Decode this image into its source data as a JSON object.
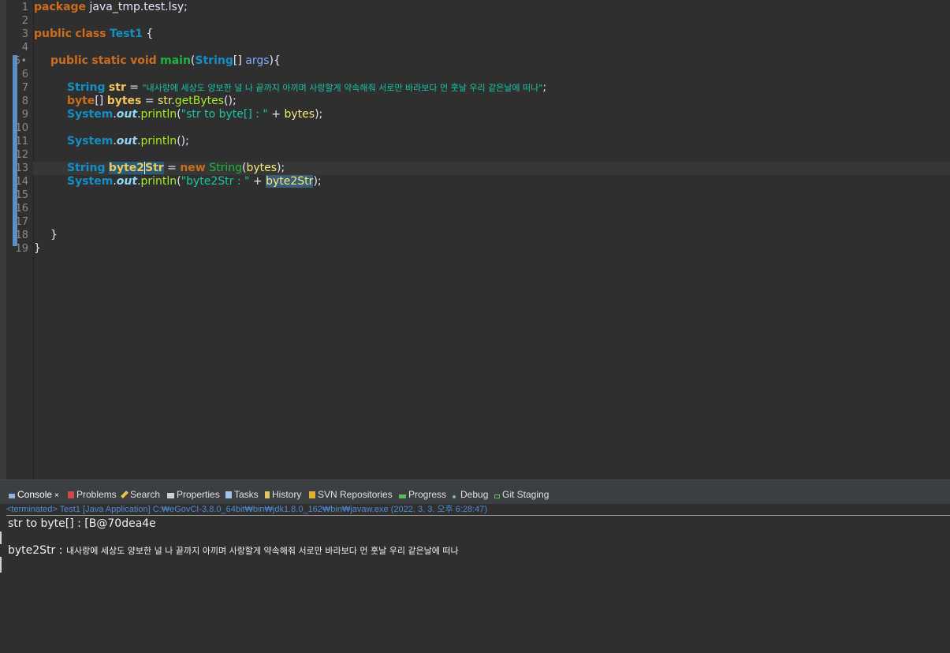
{
  "editor": {
    "line_numbers": [
      "1",
      "2",
      "3",
      "4",
      "5",
      "6",
      "7",
      "8",
      "9",
      "10",
      "11",
      "12",
      "13",
      "14",
      "15",
      "16",
      "17",
      "18",
      "19"
    ],
    "line5_marker": "•",
    "l1": {
      "kw": "package",
      "rest": " java_tmp.test.lsy;"
    },
    "l3": {
      "kw1": "public",
      "kw2": "class",
      "name": "Test1",
      "rest": " {"
    },
    "l5": {
      "kw1": "public",
      "kw2": "static",
      "kw3": "void",
      "fn": "main",
      "p1": "(",
      "type": "String",
      "p2": "[] ",
      "arg": "args",
      "p3": "){"
    },
    "l7": {
      "type": "String",
      "var": "str",
      "eq": " = ",
      "str": "\"내사랑에 세상도 양보한 널 나 끝까지 아끼며 사랑할게 약속해줘 서로만 바라보다 먼 훗날 우리 같은날에 떠나\"",
      "end": ";"
    },
    "l8": {
      "type": "byte",
      "br": "[] ",
      "var": "bytes",
      "eq": " = ",
      "obj": "str",
      "dot": ".",
      "meth": "getBytes",
      "end": "();"
    },
    "l9": {
      "cls": "System",
      "dot1": ".",
      "field": "out",
      "dot2": ".",
      "meth": "println",
      "p1": "(",
      "str": "\"str to byte[] : \"",
      "plus": " + ",
      "var": "bytes",
      "end": ");"
    },
    "l11": {
      "cls": "System",
      "dot1": ".",
      "field": "out",
      "dot2": ".",
      "meth": "println",
      "end": "();"
    },
    "l13": {
      "type": "String",
      "var_a": "byte2",
      "var_b": "S",
      "var_c": "tr",
      "eq": " = ",
      "kw": "new",
      "cls": " String",
      "p1": "(",
      "var2": "bytes",
      "end": ");"
    },
    "l14": {
      "cls": "System",
      "dot1": ".",
      "field": "out",
      "dot2": ".",
      "meth": "println",
      "p1": "(",
      "str": "\"byte2Str : \"",
      "plus": " + ",
      "var": "byte2Str",
      "end": ");"
    },
    "l18": {
      "brace": "}"
    },
    "l19": {
      "brace": "}"
    }
  },
  "console": {
    "tabs": [
      {
        "label": "Console",
        "icon": "console-icon"
      },
      {
        "label": "Problems",
        "icon": "problems-icon"
      },
      {
        "label": "Search",
        "icon": "search-icon"
      },
      {
        "label": "Properties",
        "icon": "properties-icon"
      },
      {
        "label": "Tasks",
        "icon": "tasks-icon"
      },
      {
        "label": "History",
        "icon": "history-icon"
      },
      {
        "label": "SVN Repositories",
        "icon": "svn-icon"
      },
      {
        "label": "Progress",
        "icon": "progress-icon"
      },
      {
        "label": "Debug",
        "icon": "debug-icon"
      },
      {
        "label": "Git Staging",
        "icon": "git-staging-icon"
      }
    ],
    "close_glyph": "×",
    "terminated": "<terminated> Test1 [Java Application] C:₩eGovCI-3.8.0_64bit₩bin₩jdk1.8.0_162₩bin₩javaw.exe (2022. 3. 3. 오후 6:28:47)",
    "out1": "str to byte[] : [B@70dea4e",
    "out2_label": "byte2Str : ",
    "out2_text": "내사랑에 세상도 양보한 널 나 끝까지 아끼며 사랑할게 약속해줘 서로만 바라보다 먼 훗날 우리 같은날에 떠나"
  },
  "colors": {
    "keyword": "#cc6c1d",
    "type": "#1290c3",
    "string": "#17c6a3",
    "method": "#a7ec21",
    "variable": "#f3ec79",
    "background": "#2f2f2f"
  }
}
